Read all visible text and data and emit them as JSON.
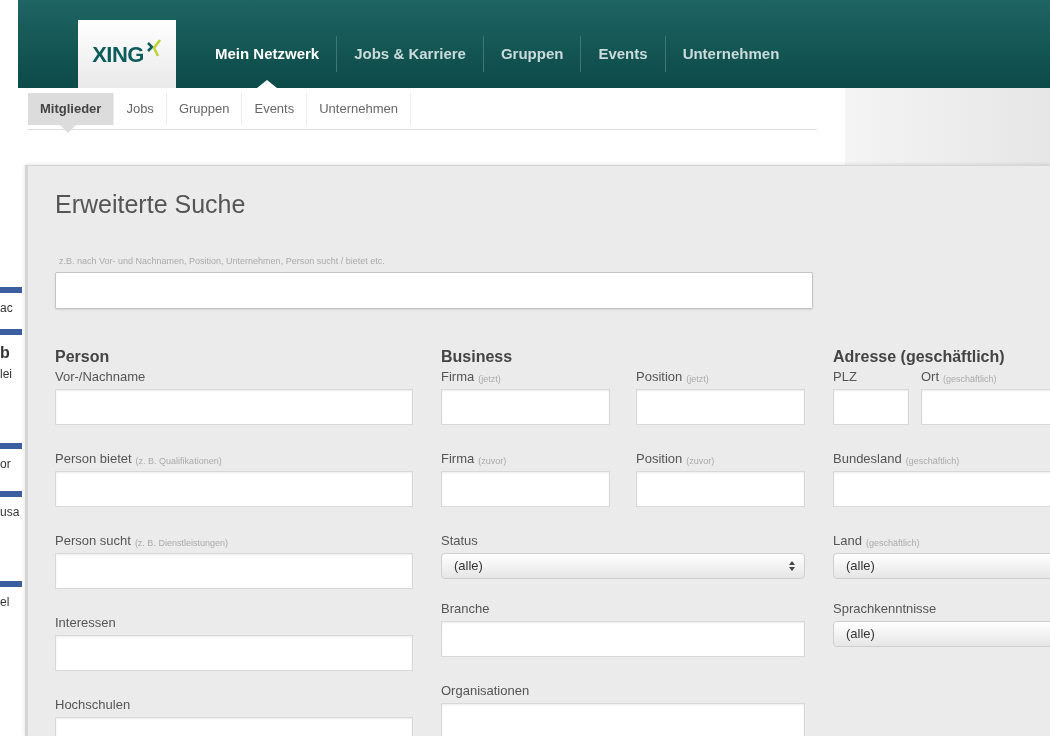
{
  "header": {
    "logo": "XING",
    "nav": [
      {
        "label": "Mein Netzwerk",
        "selected": true
      },
      {
        "label": "Jobs & Karriere",
        "selected": false
      },
      {
        "label": "Gruppen",
        "selected": false
      },
      {
        "label": "Events",
        "selected": false
      },
      {
        "label": "Unternehmen",
        "selected": false
      }
    ]
  },
  "subnav": [
    {
      "label": "Mitglieder",
      "selected": true
    },
    {
      "label": "Jobs",
      "selected": false
    },
    {
      "label": "Gruppen",
      "selected": false
    },
    {
      "label": "Events",
      "selected": false
    },
    {
      "label": "Unternehmen",
      "selected": false
    }
  ],
  "background_page": [
    {
      "kind": "text",
      "text": "ac"
    },
    {
      "kind": "bold",
      "text": "b"
    },
    {
      "kind": "text",
      "text": "lei"
    },
    {
      "kind": "text",
      "text": "or"
    },
    {
      "kind": "text",
      "text": "usa"
    },
    {
      "kind": "text",
      "text": "el"
    }
  ],
  "search": {
    "title": "Erweiterte Suche",
    "hint": "z.B. nach Vor- und Nachnamen, Position, Unternehmen, Person sucht / bietet etc."
  },
  "columns": [
    {
      "heading": "Person",
      "rows": [
        [
          {
            "kind": "input",
            "label": "Vor-/Nachname"
          }
        ],
        [
          {
            "kind": "input",
            "label": "Person bietet",
            "note": "(z. B. Qualifikationen)"
          }
        ],
        [
          {
            "kind": "input",
            "label": "Person sucht",
            "note": "(z. B. Dienstleistungen)"
          }
        ],
        [
          {
            "kind": "input",
            "label": "Interessen"
          }
        ],
        [
          {
            "kind": "input",
            "label": "Hochschulen"
          }
        ]
      ]
    },
    {
      "heading": "Business",
      "rows": [
        [
          {
            "kind": "input",
            "label": "Firma",
            "note": "(jetzt)"
          },
          {
            "kind": "input",
            "label": "Position",
            "note": "(jetzt)"
          }
        ],
        [
          {
            "kind": "input",
            "label": "Firma",
            "note": "(zuvor)"
          },
          {
            "kind": "input",
            "label": "Position",
            "note": "(zuvor)"
          }
        ],
        [
          {
            "kind": "select",
            "label": "Status",
            "value": "(alle)"
          }
        ],
        [
          {
            "kind": "input",
            "label": "Branche"
          }
        ],
        [
          {
            "kind": "input",
            "label": "Organisationen"
          }
        ]
      ]
    },
    {
      "heading": "Adresse (geschäftlich)",
      "rows": [
        [
          {
            "kind": "input",
            "label": "PLZ"
          },
          {
            "kind": "input",
            "label": "Ort",
            "note": "(geschäftlich)"
          }
        ],
        [
          {
            "kind": "input",
            "label": "Bundesland",
            "note": "(geschäftlich)"
          }
        ],
        [
          {
            "kind": "select",
            "label": "Land",
            "note": "(geschäftlich)",
            "value": "(alle)"
          }
        ],
        [
          {
            "kind": "select",
            "label": "Sprachkenntnisse",
            "value": "(alle)"
          }
        ]
      ]
    }
  ]
}
